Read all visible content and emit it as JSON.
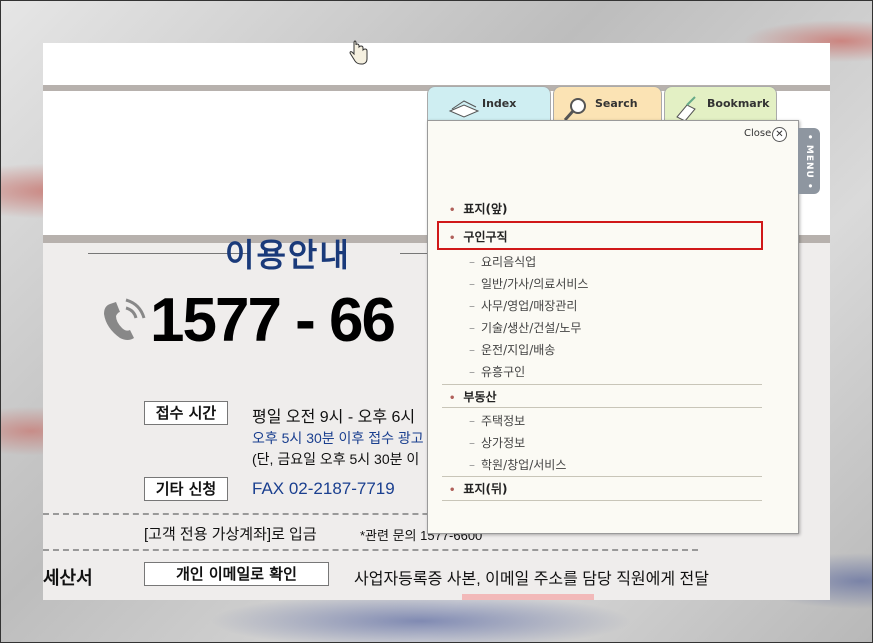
{
  "document": {
    "title": "이용안내",
    "phone": "1577 - 66",
    "reception_label": "접수 시간",
    "reception_time": "평일 오전 9시 - 오후 6시",
    "reception_note1": "오후 5시 30분 이후 접수 광고",
    "reception_note2": "(단, 금요일 오후 5시 30분 이",
    "other_label": "기타 신청",
    "fax": "FAX  02-2187-7719",
    "account_text": "[고객 전용 가상계좌]로 입금",
    "inquiry_text": "*관련 문의 1577-6600",
    "invoice_text": "세산서",
    "email_button": "개인 이메일로 확인",
    "email_desc": "사업자등록증 사본, 이메일 주소를 담당 직원에게 전달"
  },
  "panel": {
    "tabs": [
      {
        "label": "Index",
        "icon": "index-book-icon",
        "color": "#cfeef2"
      },
      {
        "label": "Search",
        "icon": "magnifier-icon",
        "color": "#fbe3b4"
      },
      {
        "label": "Bookmark",
        "icon": "bookmark-icon",
        "color": "#e3f0c4"
      }
    ],
    "close_label": "Close",
    "menu_label": "• MENU •",
    "sections": [
      {
        "label": "표지(앞)",
        "items": []
      },
      {
        "label": "구인구직",
        "items": [
          "요리음식업",
          "일반/가사/의료서비스",
          "사무/영업/매장관리",
          "기술/생산/건설/노무",
          "운전/지입/배송",
          "유흥구인"
        ]
      },
      {
        "label": "부동산",
        "items": [
          "주택정보",
          "상가정보",
          "학원/창업/서비스"
        ]
      },
      {
        "label": "표지(뒤)",
        "items": []
      }
    ],
    "highlighted_section": "구인구직"
  }
}
